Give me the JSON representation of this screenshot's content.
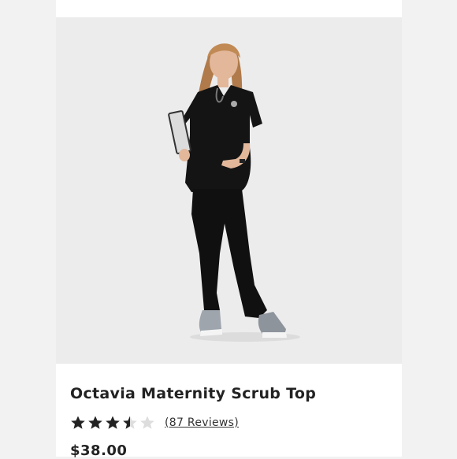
{
  "product": {
    "title": "Octavia Maternity Scrub Top",
    "rating_value": 3.5,
    "rating_max": 5,
    "reviews_label": "(87 Reviews)",
    "price": "$38.00"
  },
  "gallery": {
    "image_count": 7,
    "active_index": 1
  },
  "colors": {
    "page_bg": "#f2f2f2",
    "photo_bg": "#ececec",
    "star_filled": "#222222",
    "star_empty": "#dddddd",
    "dot_active": "#3a3a3a",
    "dot_inactive": "#b9b9b9"
  },
  "icons": [
    "star-icon",
    "half-star-icon",
    "empty-star-icon"
  ]
}
